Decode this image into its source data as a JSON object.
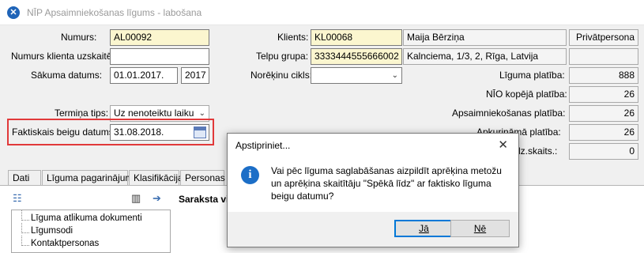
{
  "window": {
    "title": "NĪP Apsaimniekošanas līgums - labošana"
  },
  "left_form": {
    "numurs_label": "Numurs:",
    "numurs_value": "AL00092",
    "klienta_numurs_label": "Numurs klienta uzskaitē:",
    "klienta_numurs_value": "",
    "sakuma_label": "Sākuma datums:",
    "sakuma_value": "01.01.2017.",
    "sakuma_year": "2017",
    "termina_label": "Termiņa tips:",
    "termina_value": "Uz nenoteiktu laiku",
    "beigu_label": "Faktiskais beigu datums:",
    "beigu_value": "31.08.2018."
  },
  "mid_form": {
    "klients_label": "Klients:",
    "klients_code": "KL00068",
    "klients_name": "Maija Bērziņa",
    "klients_type": "Privātpersona",
    "telpu_label": "Telpu grupa:",
    "telpu_code": "3333444555666002",
    "telpu_address": "Kalnciema, 1/3, 2, Rīga, Latvija",
    "telpu_extra": "",
    "norekinu_label": "Norēķinu cikls:",
    "norekinu_value": ""
  },
  "right_form": {
    "liguma_platiba_label": "Līguma platība:",
    "liguma_platiba_value": "888",
    "nio_platiba_label": "NĪO kopējā platība:",
    "nio_platiba_value": "26",
    "apsaim_platiba_label": "Apsaimniekošanas platība:",
    "apsaim_platiba_value": "26",
    "apkurinama_label": "Apkurināmā platība:",
    "apkurinama_value": "26",
    "iedz_label": "Iedz.skaits.:",
    "iedz_value": "0"
  },
  "tabs": [
    "Dati",
    "Līguma pagarinājumi",
    "Klasifikācija",
    "Personas"
  ],
  "tree": {
    "items": [
      "Līguma atlikuma dokumenti",
      "Līgumsodi",
      "Kontaktpersonas"
    ]
  },
  "list_header": "Saraksta vi",
  "dialog": {
    "title": "Apstipriniet...",
    "message": "Vai pēc līguma saglabāšanas aizpildīt aprēķina metožu un aprēķina skaitītāju \"Spēkā līdz\" ar faktisko līguma beigu datumu?",
    "yes_label": "Jā",
    "no_label": "Nē"
  },
  "colors": {
    "highlight": "#e1393a",
    "required_field": "#fbf6cf",
    "accent": "#0078d7"
  }
}
